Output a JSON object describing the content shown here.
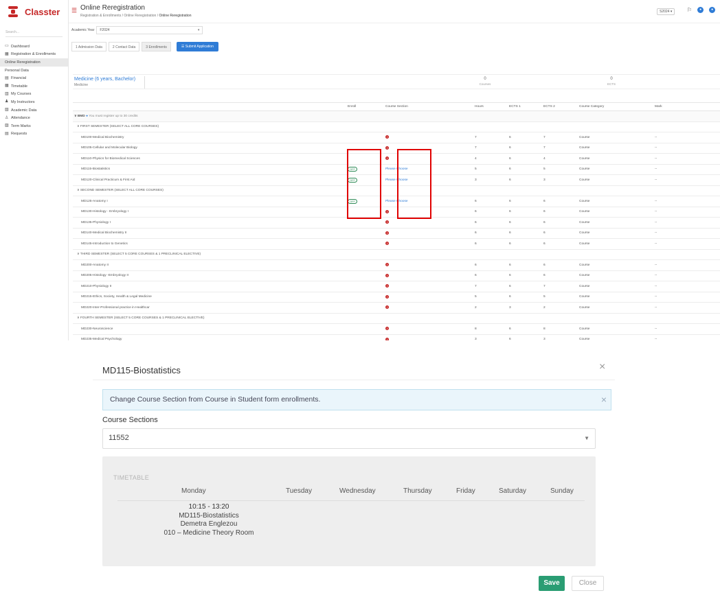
{
  "app": {
    "brand": "Classter",
    "search_placeholder": "Search..."
  },
  "sidebar": {
    "items": [
      {
        "label": "Dashboard",
        "icon": "monitor-icon"
      },
      {
        "label": "Registration & Enrollments",
        "icon": "calendar-icon"
      },
      {
        "label": "Online Reregistration",
        "sub": true
      },
      {
        "label": "Personal Data",
        "sub": true
      },
      {
        "label": "Financial",
        "icon": "money-icon"
      },
      {
        "label": "Timetable",
        "icon": "calendar-icon"
      },
      {
        "label": "My Courses",
        "icon": "books-icon"
      },
      {
        "label": "My Instructors",
        "icon": "people-icon"
      },
      {
        "label": "Academic Data",
        "icon": "chart-icon"
      },
      {
        "label": "Attendance",
        "icon": "user-check-icon"
      },
      {
        "label": "Term Marks",
        "icon": "grade-icon"
      },
      {
        "label": "Requests",
        "icon": "document-icon"
      }
    ]
  },
  "header": {
    "title": "Online Reregistration",
    "breadcrumb": [
      "Registration & Enrollments",
      "Online Reregistration",
      "Online Reregistration"
    ],
    "term": "S2024 ▾"
  },
  "form": {
    "academic_year_label": "Academic Year",
    "academic_year_value": "F2024",
    "steps": [
      "1 Admission Data",
      "2 Contact Data",
      "3 Enrollments"
    ],
    "submit_label": "☰ Submit Application"
  },
  "program": {
    "title": "Medicine (6 years, Bachelor)",
    "subtitle": "Medicine",
    "courses_value": "0",
    "courses_label": "Courses",
    "ects_value": "0",
    "ects_label": "ECTS"
  },
  "table": {
    "headers": [
      "",
      "Enroll",
      "Course Section",
      "Hours",
      "ECTS 1",
      "ECTS 2",
      "Course Category",
      "Mark"
    ],
    "group": {
      "label": "∨  BMD",
      "note": "You must register up to 30 credits"
    },
    "rows": [
      {
        "type": "sem",
        "name": "∨  FIRST SEMESTER (SELECT ALL CORE COURSES)"
      },
      {
        "type": "course",
        "name": "MD100-Medical Biochemistry",
        "enroll": "",
        "section": "!",
        "hours": "7",
        "e1": "6",
        "e2": "7",
        "cat": "Course",
        "mark": "--"
      },
      {
        "type": "course",
        "name": "MD105-Cellular and Molecular Biology",
        "enroll": "",
        "section": "!",
        "hours": "7",
        "e1": "6",
        "e2": "7",
        "cat": "Course",
        "mark": "--"
      },
      {
        "type": "course",
        "name": "MD110-Physics for Biomedical Sciences",
        "enroll": "",
        "section": "!",
        "hours": "4",
        "e1": "6",
        "e2": "4",
        "cat": "Course",
        "mark": "--"
      },
      {
        "type": "course",
        "name": "MD115-Biostatistics",
        "enroll": "OFF",
        "section": "Please Choose",
        "hours": "5",
        "e1": "6",
        "e2": "5",
        "cat": "Course",
        "mark": "--"
      },
      {
        "type": "course",
        "name": "MD120-Clinical Practicum & First Aid",
        "enroll": "OFF",
        "section": "Please Choose",
        "hours": "3",
        "e1": "6",
        "e2": "3",
        "cat": "Course",
        "mark": "--"
      },
      {
        "type": "sem",
        "name": "∨  SECOND SEMESTER (SELECT ALL CORE COURSES)"
      },
      {
        "type": "course",
        "name": "MD125-Anatomy I",
        "enroll": "OFF",
        "section": "Please Choose",
        "hours": "6",
        "e1": "6",
        "e2": "6",
        "cat": "Course",
        "mark": "--"
      },
      {
        "type": "course",
        "name": "MD130-Histology - Embryology I",
        "enroll": "",
        "section": "!",
        "hours": "6",
        "e1": "6",
        "e2": "6",
        "cat": "Course",
        "mark": "--"
      },
      {
        "type": "course",
        "name": "MD135-Physiology I",
        "enroll": "",
        "section": "!",
        "hours": "6",
        "e1": "6",
        "e2": "6",
        "cat": "Course",
        "mark": "--"
      },
      {
        "type": "course",
        "name": "MD140-Medical Biochemistry II",
        "enroll": "",
        "section": "!",
        "hours": "6",
        "e1": "6",
        "e2": "6",
        "cat": "Course",
        "mark": "--"
      },
      {
        "type": "course",
        "name": "MD145-Introduction to Genetics",
        "enroll": "",
        "section": "!",
        "hours": "6",
        "e1": "6",
        "e2": "6",
        "cat": "Course",
        "mark": "--"
      },
      {
        "type": "sem",
        "name": "∨  THIRD SEMESTER (SELECT 5 CORE COURSES & 1 PRECLINICAL ELECTIVE)"
      },
      {
        "type": "course",
        "name": "MD200-Anatomy II",
        "enroll": "",
        "section": "!",
        "hours": "6",
        "e1": "6",
        "e2": "6",
        "cat": "Course",
        "mark": "--"
      },
      {
        "type": "course",
        "name": "MD205-Histology -Embryology II",
        "enroll": "",
        "section": "!",
        "hours": "6",
        "e1": "6",
        "e2": "6",
        "cat": "Course",
        "mark": "--"
      },
      {
        "type": "course",
        "name": "MD210-Physiology II",
        "enroll": "",
        "section": "!",
        "hours": "7",
        "e1": "6",
        "e2": "7",
        "cat": "Course",
        "mark": "--"
      },
      {
        "type": "course",
        "name": "MD215-Ethics, Society, Health & Legal Medicine",
        "enroll": "",
        "section": "!",
        "hours": "5",
        "e1": "6",
        "e2": "5",
        "cat": "Course",
        "mark": "--"
      },
      {
        "type": "course",
        "name": "MD220-Inter-Professional practice in Healthcar",
        "enroll": "",
        "section": "!",
        "hours": "2",
        "e1": "3",
        "e2": "2",
        "cat": "Course",
        "mark": "--"
      },
      {
        "type": "sem",
        "name": "∨  FOURTH SEMESTER (SELECT 5 CORE COURSES & 1 PRECLINICAL ELECTIVE)"
      },
      {
        "type": "course",
        "name": "MD230-Neuroscience",
        "enroll": "",
        "section": "!",
        "hours": "8",
        "e1": "6",
        "e2": "8",
        "cat": "Course",
        "mark": "--"
      },
      {
        "type": "course",
        "name": "MD235-Medical Psychology",
        "enroll": "",
        "section": "!",
        "hours": "3",
        "e1": "6",
        "e2": "3",
        "cat": "Course",
        "mark": "--"
      }
    ]
  },
  "modal": {
    "title": "MD115-Biostatistics",
    "alert": "Change Course Section from Course in Student form enrollments.",
    "section_label": "Course Sections",
    "section_value": "11552",
    "timetable_label": "TIMETABLE",
    "days": [
      "Monday",
      "Tuesday",
      "Wednesday",
      "Thursday",
      "Friday",
      "Saturday",
      "Sunday"
    ],
    "entry": {
      "time": "10:15 - 13:20",
      "course": "MD115-Biostatistics",
      "instructor": "Demetra Englezou",
      "room": "010 – Medicine Theory Room"
    },
    "save_label": "Save",
    "close_label": "Close"
  },
  "colors": {
    "brand": "#c62828",
    "accent": "#2f7cd6",
    "save": "#2a9d73",
    "highlight": "#e00000"
  }
}
